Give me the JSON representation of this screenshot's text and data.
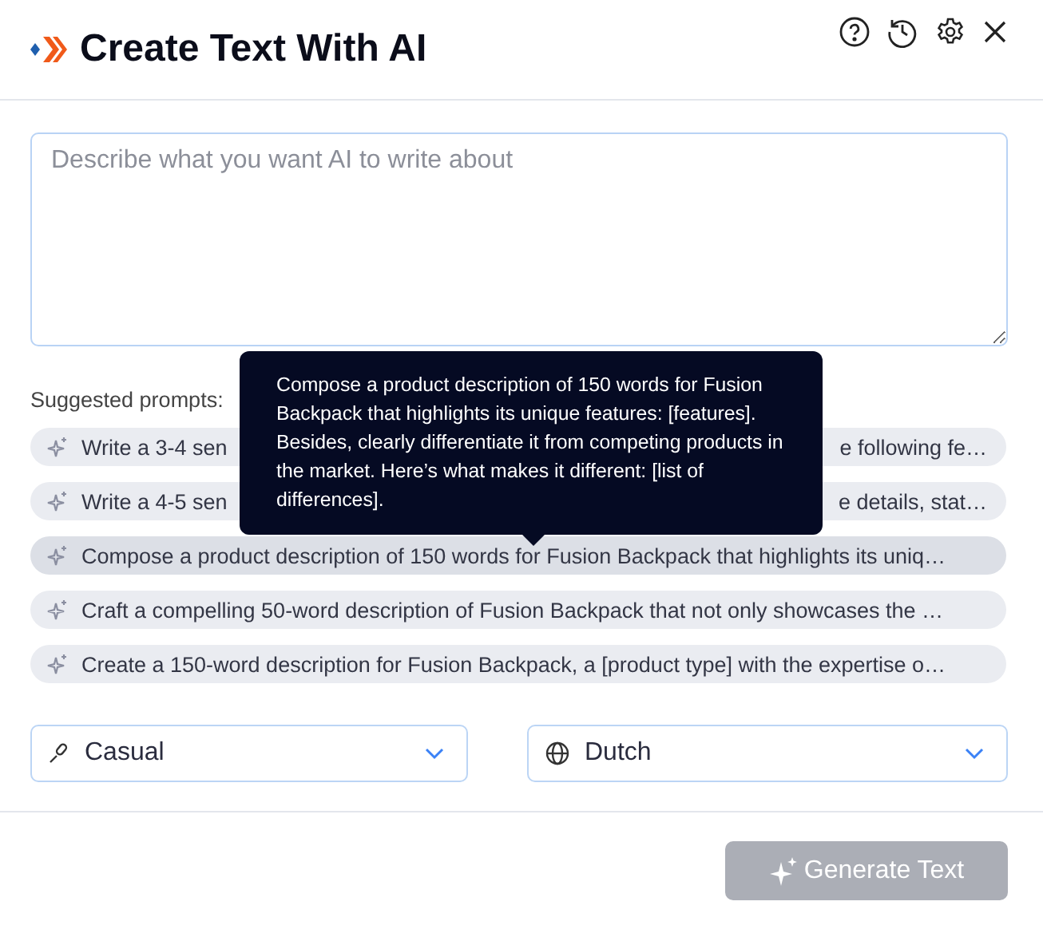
{
  "header": {
    "title": "Create Text With AI"
  },
  "prompt_field": {
    "placeholder": "Describe what you want AI to write about"
  },
  "suggested_label": "Suggested prompts:",
  "prompts": [
    {
      "kind": "covered",
      "text_start": "Write a 3-4 sen",
      "text_end": "e following fe…",
      "hovered": false
    },
    {
      "kind": "covered",
      "text_start": "Write a 4-5 sen",
      "text_end": "e details, stat…",
      "hovered": false
    },
    {
      "kind": "full",
      "text": "Compose a product description of 150 words for Fusion Backpack that highlights its uniq…",
      "hovered": true
    },
    {
      "kind": "full",
      "text": "Craft a compelling 50-word description of Fusion Backpack that not only showcases the …",
      "hovered": false
    },
    {
      "kind": "full",
      "text": "Create a 150-word description for Fusion Backpack, a [product type] with the expertise o…",
      "hovered": false
    }
  ],
  "tooltip": "Compose a product description of 150 words for Fusion Backpack that highlights its unique features: [features]. Besides, clearly differentiate it from competing products in the market. Here’s what makes it different: [list of differences].",
  "tone_select": {
    "value": "Casual"
  },
  "language_select": {
    "value": "Dutch"
  },
  "generate_button": {
    "label": "Generate Text",
    "disabled": true
  }
}
